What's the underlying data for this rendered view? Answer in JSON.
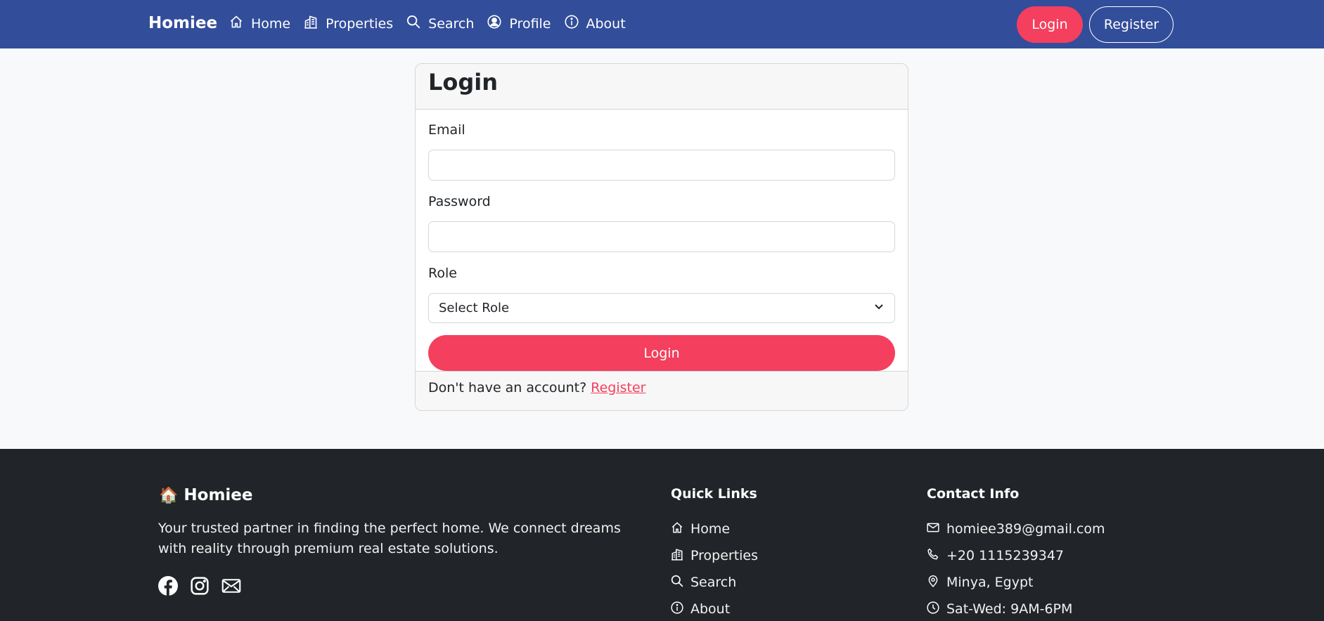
{
  "navbar": {
    "brand": "Homiee",
    "links": [
      {
        "label": "Home",
        "icon": "home-icon"
      },
      {
        "label": "Properties",
        "icon": "building-icon"
      },
      {
        "label": "Search",
        "icon": "search-icon"
      },
      {
        "label": "Profile",
        "icon": "user-circle-icon"
      },
      {
        "label": "About",
        "icon": "info-icon"
      }
    ],
    "login_label": "Login",
    "register_label": "Register"
  },
  "login_card": {
    "title": "Login",
    "email_label": "Email",
    "email_value": "",
    "password_label": "Password",
    "password_value": "",
    "role_label": "Role",
    "role_selected": "Select Role",
    "submit_label": "Login",
    "footer_text": "Don't have an account?",
    "footer_link": "Register"
  },
  "footer": {
    "brand_icon": "🏠",
    "brand": "Homiee",
    "description": "Your trusted partner in finding the perfect home. We connect dreams with reality through premium real estate solutions.",
    "socials": [
      "facebook-icon",
      "instagram-icon",
      "envelope-icon"
    ],
    "quick_links_title": "Quick Links",
    "quick_links": [
      {
        "label": "Home",
        "icon": "home-icon"
      },
      {
        "label": "Properties",
        "icon": "building-icon"
      },
      {
        "label": "Search",
        "icon": "search-icon"
      },
      {
        "label": "About",
        "icon": "info-icon"
      }
    ],
    "contact_title": "Contact Info",
    "contact": [
      {
        "label": "homiee389@gmail.com",
        "icon": "envelope-icon"
      },
      {
        "label": "+20 1115239347",
        "icon": "phone-icon"
      },
      {
        "label": "Minya, Egypt",
        "icon": "location-pin-icon"
      },
      {
        "label": "Sat-Wed: 9AM-6PM",
        "icon": "clock-icon"
      }
    ]
  },
  "colors": {
    "navbar_bg": "#324d9a",
    "accent": "#f43f5e",
    "footer_bg": "#212529",
    "page_bg": "#f8f9fa"
  }
}
